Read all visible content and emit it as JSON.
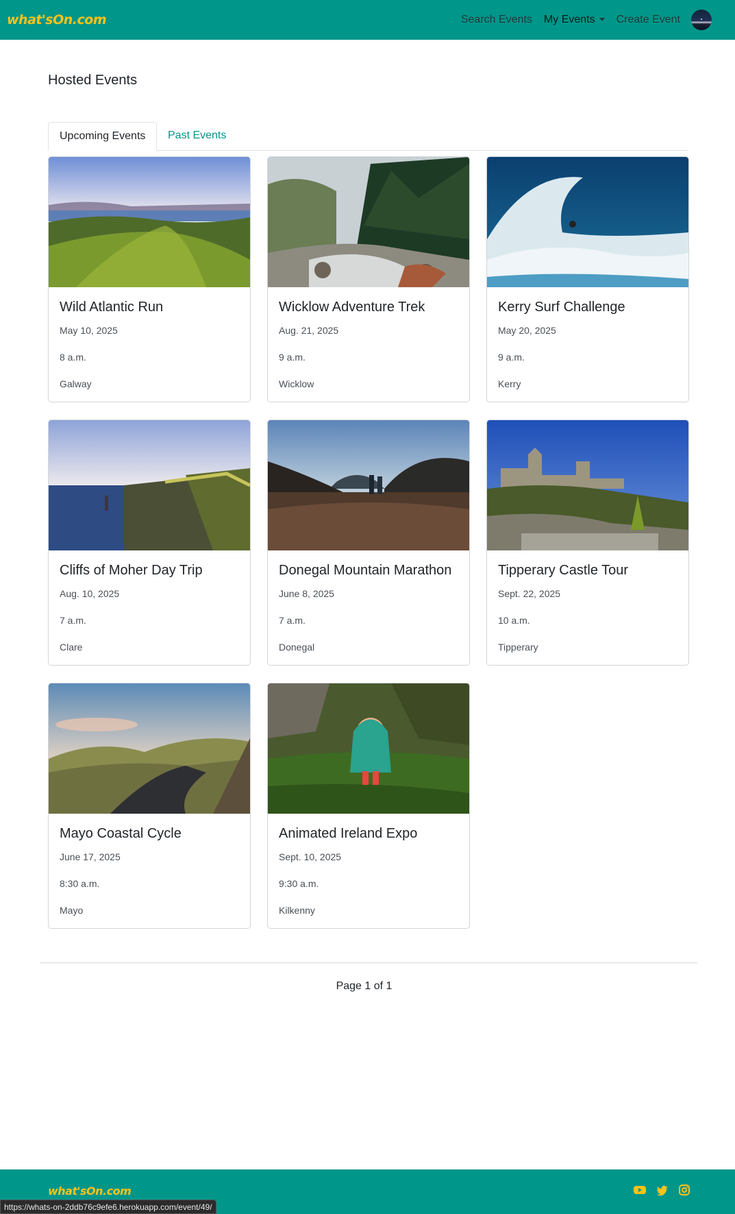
{
  "navbar": {
    "brand": "what'sOn.com",
    "links": [
      "Search Events",
      "My Events",
      "Create Event"
    ]
  },
  "page": {
    "title": "Hosted Events",
    "tabs": [
      "Upcoming Events",
      "Past Events"
    ]
  },
  "events": [
    {
      "title": "Wild Atlantic Run",
      "date": "May 10, 2025",
      "time": "8 a.m.",
      "location": "Galway"
    },
    {
      "title": "Wicklow Adventure Trek",
      "date": "Aug. 21, 2025",
      "time": "9 a.m.",
      "location": "Wicklow"
    },
    {
      "title": "Kerry Surf Challenge",
      "date": "May 20, 2025",
      "time": "9 a.m.",
      "location": "Kerry"
    },
    {
      "title": "Cliffs of Moher Day Trip",
      "date": "Aug. 10, 2025",
      "time": "7 a.m.",
      "location": "Clare"
    },
    {
      "title": "Donegal Mountain Marathon",
      "date": "June 8, 2025",
      "time": "7 a.m.",
      "location": "Donegal"
    },
    {
      "title": "Tipperary Castle Tour",
      "date": "Sept. 22, 2025",
      "time": "10 a.m.",
      "location": "Tipperary"
    },
    {
      "title": "Mayo Coastal Cycle",
      "date": "June 17, 2025",
      "time": "8:30 a.m.",
      "location": "Mayo"
    },
    {
      "title": "Animated Ireland Expo",
      "date": "Sept. 10, 2025",
      "time": "9:30 a.m.",
      "location": "Kilkenny"
    }
  ],
  "pagination": {
    "text": "Page 1 of 1"
  },
  "footer": {
    "brand": "what'sOn.com",
    "social_icons": [
      "youtube-icon",
      "twitter-icon",
      "instagram-icon"
    ]
  },
  "status_bar": {
    "url": "https://whats-on-2ddb76c9efe6.herokuapp.com/event/49/"
  },
  "colors": {
    "primary": "#00968a",
    "brand": "#ffc21a"
  }
}
